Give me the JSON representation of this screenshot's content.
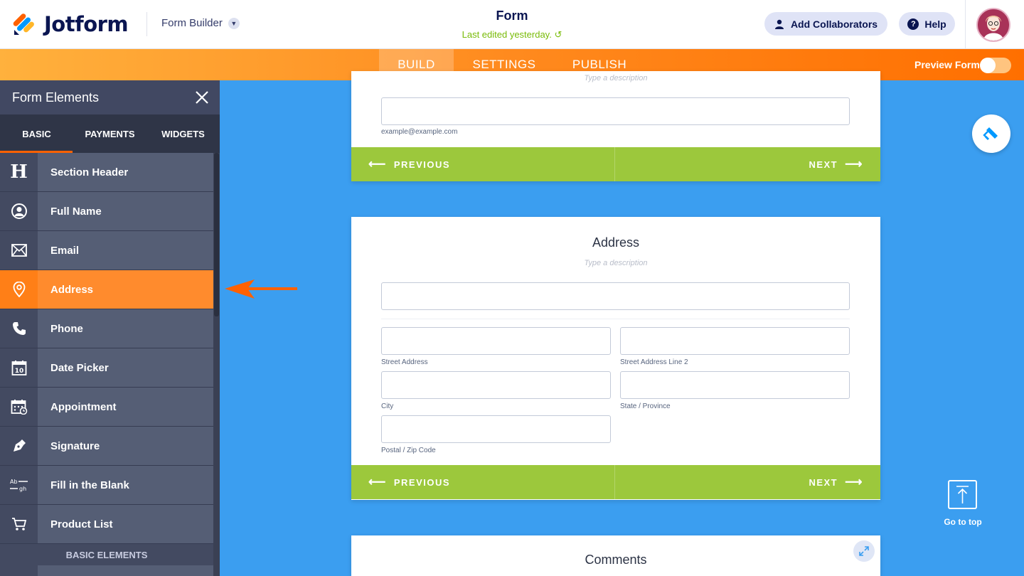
{
  "header": {
    "brand": "Jotform",
    "builder_label": "Form Builder",
    "form_title": "Form",
    "last_edited": "Last edited yesterday.",
    "collaborators_label": "Add Collaborators",
    "help_label": "Help"
  },
  "nav": {
    "tabs": [
      "BUILD",
      "SETTINGS",
      "PUBLISH"
    ],
    "active_tab": "BUILD",
    "preview_label": "Preview Form",
    "preview_on": false
  },
  "sidebar": {
    "title": "Form Elements",
    "tabs": [
      "BASIC",
      "PAYMENTS",
      "WIDGETS"
    ],
    "active_tab": "BASIC",
    "items": [
      {
        "label": "Section Header",
        "icon": "heading-icon"
      },
      {
        "label": "Full Name",
        "icon": "user-icon"
      },
      {
        "label": "Email",
        "icon": "envelope-icon"
      },
      {
        "label": "Address",
        "icon": "location-pin-icon"
      },
      {
        "label": "Phone",
        "icon": "phone-icon"
      },
      {
        "label": "Date Picker",
        "icon": "calendar-icon"
      },
      {
        "label": "Appointment",
        "icon": "appointment-icon"
      },
      {
        "label": "Signature",
        "icon": "pen-icon"
      },
      {
        "label": "Fill in the Blank",
        "icon": "fill-blank-icon"
      },
      {
        "label": "Product List",
        "icon": "cart-icon"
      }
    ],
    "active_item": "Address",
    "section_label": "BASIC ELEMENTS"
  },
  "email_card": {
    "description_placeholder": "Type a description",
    "sublabel": "example@example.com",
    "prev_label": "PREVIOUS",
    "next_label": "NEXT"
  },
  "address_card": {
    "title": "Address",
    "description_placeholder": "Type a description",
    "sublabels": {
      "street": "Street Address",
      "street2": "Street Address Line 2",
      "city": "City",
      "state": "State / Province",
      "postal": "Postal / Zip Code"
    },
    "prev_label": "PREVIOUS",
    "next_label": "NEXT"
  },
  "comments_card": {
    "title": "Comments"
  },
  "tools": {
    "go_top_label": "Go to top"
  },
  "colors": {
    "brand_orange": "#ff6100",
    "canvas_blue": "#3b9ef0",
    "footer_green": "#9cc83c",
    "sidebar_bg": "#414862",
    "navy": "#0a1551"
  }
}
